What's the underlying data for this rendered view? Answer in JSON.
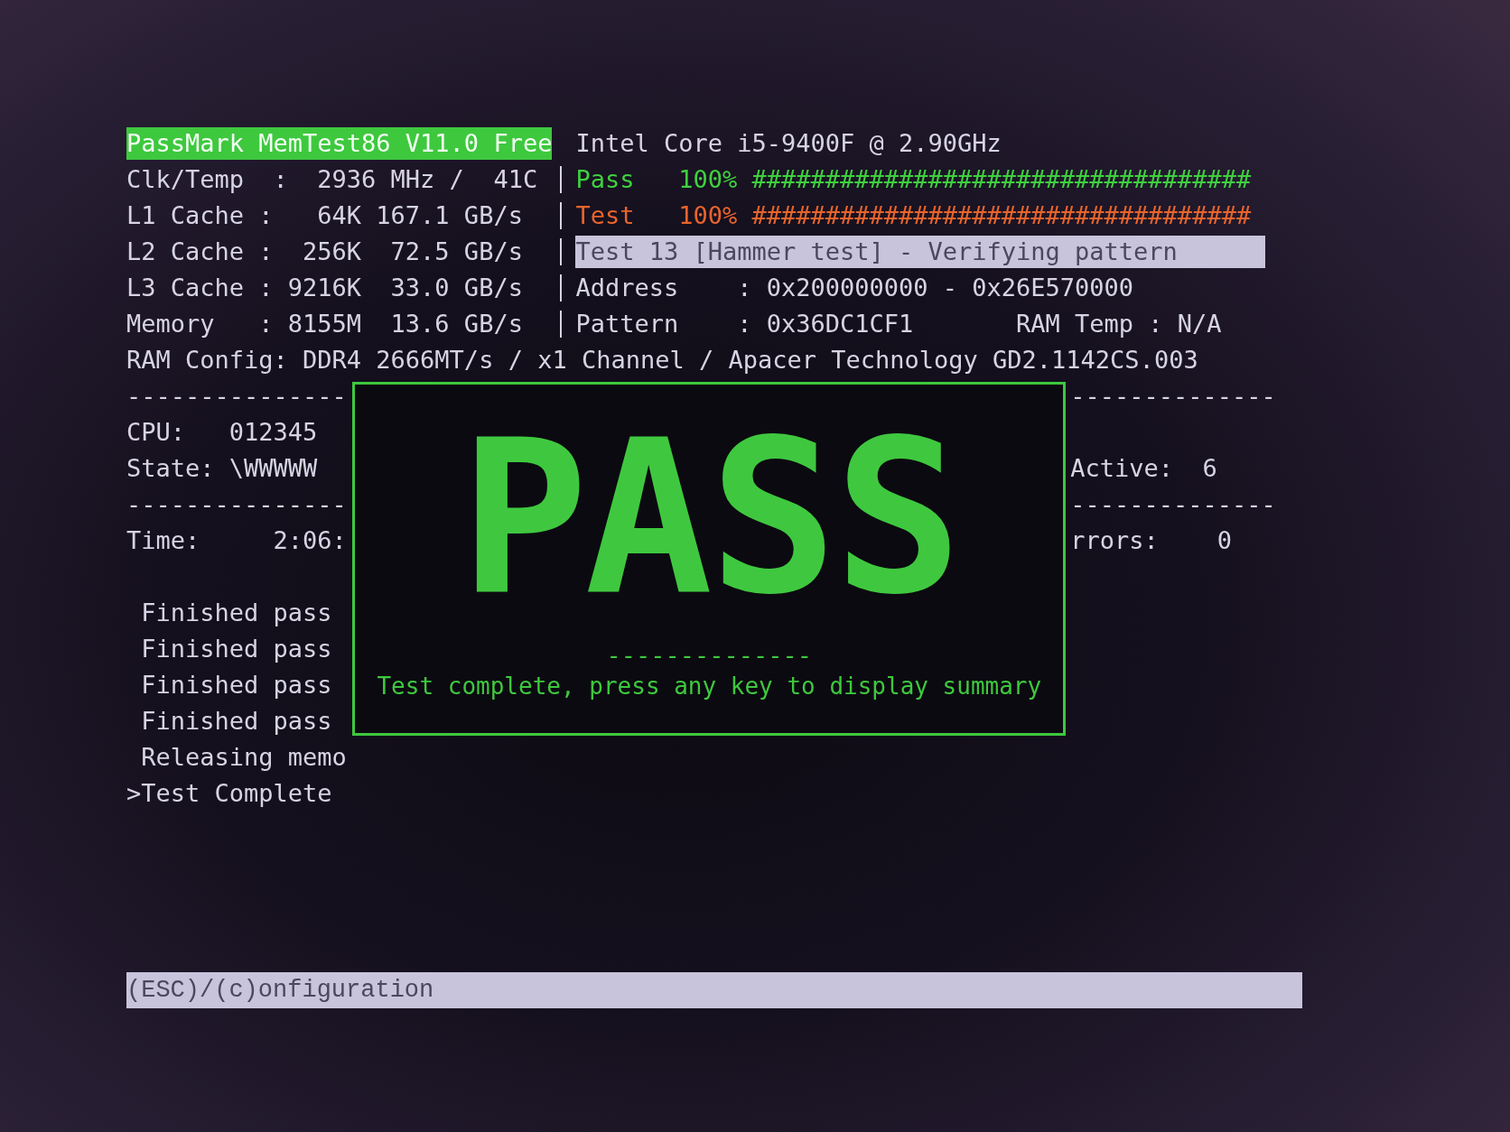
{
  "header": {
    "title": "PassMark MemTest86 V11.0 Free",
    "cpu_model": "Intel Core i5-9400F @ 2.90GHz"
  },
  "system_info": [
    "Clk/Temp  :  2936 MHz /  41C",
    "L1 Cache :   64K 167.1 GB/s",
    "L2 Cache :  256K  72.5 GB/s",
    "L3 Cache : 9216K  33.0 GB/s",
    "Memory   : 8155M  13.6 GB/s"
  ],
  "progress": [
    {
      "label": "Pass",
      "percent": "100%",
      "bar": "##################################",
      "color": "#3fd03f"
    },
    {
      "label": "Test",
      "percent": "100%",
      "bar": "##################################",
      "color": "#e8642c"
    }
  ],
  "current_test": "Test 13 [Hammer test] - Verifying pattern",
  "address": "Address    : 0x200000000 - 0x26E570000",
  "pattern": "Pattern    : 0x36DC1CF1",
  "ram_temp": "RAM Temp : N/A",
  "ram_config": "RAM Config: DDR4 2666MT/s / x1 Channel / Apacer Technology GD2.1142CS.003",
  "left_panel": {
    "rule_top": "---------------",
    "cpu": "CPU:   012345",
    "state": "State: \\WWWWW",
    "rule_mid": "---------------",
    "time": "Time:     2:06:"
  },
  "right_panel": {
    "rule_top": "--------------",
    "active": "Active:  6",
    "rule_mid": "--------------",
    "errors": "rrors:    0"
  },
  "log": [
    " Finished pass",
    " Finished pass",
    " Finished pass",
    " Finished pass",
    " Releasing memo",
    ">Test Complete"
  ],
  "result_box": {
    "result": "PASS",
    "divider": "--------------",
    "message": "Test complete, press any key to display summary"
  },
  "footer": "(ESC)/(c)onfiguration"
}
